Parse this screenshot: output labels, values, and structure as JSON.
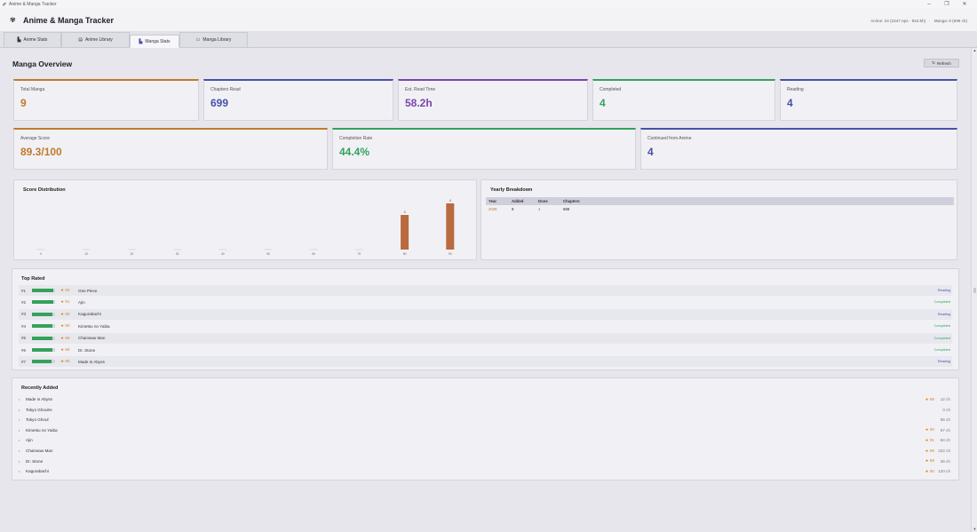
{
  "window": {
    "title": "Anime & Manga Tracker",
    "controls": [
      "–",
      "❐",
      "✕"
    ]
  },
  "header": {
    "title": "Anime & Manga Tracker",
    "anime_stat": "Anime: 24 (2347 eps · 934.5h)",
    "separator": "·",
    "manga_stat": "Manga: 9 (699 ch)"
  },
  "tabs": [
    {
      "label": "Anime Stats",
      "icon": "chart-icon",
      "active": false
    },
    {
      "label": "Anime Library",
      "icon": "library-icon",
      "active": false
    },
    {
      "label": "Manga Stats",
      "icon": "chart-icon",
      "active": true
    },
    {
      "label": "Manga Library",
      "icon": "book-icon",
      "active": false
    }
  ],
  "page": {
    "title": "Manga Overview",
    "refresh_label": "Refresh"
  },
  "stats_row1": [
    {
      "label": "Total Manga",
      "value": "9",
      "color": "#c07a2c"
    },
    {
      "label": "Chapters Read",
      "value": "699",
      "color": "#4650a8"
    },
    {
      "label": "Est. Read Time",
      "value": "58.2h",
      "color": "#7b44ad"
    },
    {
      "label": "Completed",
      "value": "4",
      "color": "#33a25c"
    },
    {
      "label": "Reading",
      "value": "4",
      "color": "#4650a8"
    }
  ],
  "stats_row2": [
    {
      "label": "Average Score",
      "value": "89.3/100",
      "color": "#c07a2c"
    },
    {
      "label": "Completion Rate",
      "value": "44.4%",
      "color": "#33a25c"
    },
    {
      "label": "Continued from Anime",
      "value": "4",
      "color": "#4650a8"
    }
  ],
  "score_distribution": {
    "title": "Score Distribution",
    "bar_color": "#b96a3e",
    "chart_data": {
      "type": "bar",
      "categories": [
        "0",
        "10",
        "20",
        "30",
        "40",
        "50",
        "60",
        "70",
        "80",
        "90"
      ],
      "values": [
        0,
        0,
        0,
        0,
        0,
        0,
        0,
        0,
        3,
        4
      ],
      "value_labels": [
        "",
        "",
        "",
        "",
        "",
        "",
        "",
        "",
        "3",
        "4"
      ],
      "ylim": [
        0,
        4
      ],
      "grid": false
    }
  },
  "yearly": {
    "title": "Yearly Breakdown",
    "headers": [
      "Year",
      "Added",
      "Done",
      "Chapters"
    ],
    "rows": [
      {
        "year": "2026",
        "added": "9",
        "done": "4",
        "chapters": "699"
      }
    ]
  },
  "top_rated": {
    "title": "Top Rated",
    "items": [
      {
        "rank": "#1",
        "score": "★ 92",
        "pct": 0.92,
        "name": "One Piece",
        "status": "Reading",
        "status_color": "#4650a8"
      },
      {
        "rank": "#2",
        "score": "★ 91",
        "pct": 0.91,
        "name": "Ajin",
        "status": "Completed",
        "status_color": "#33a25c"
      },
      {
        "rank": "#3",
        "score": "★ 90",
        "pct": 0.9,
        "name": "Kagurabachi",
        "status": "Reading",
        "status_color": "#4650a8"
      },
      {
        "rank": "#4",
        "score": "★ 90",
        "pct": 0.9,
        "name": "Kimetsu no Yaiba",
        "status": "Completed",
        "status_color": "#33a25c"
      },
      {
        "rank": "#5",
        "score": "★ 89",
        "pct": 0.89,
        "name": "Chainsaw Man",
        "status": "Completed",
        "status_color": "#33a25c"
      },
      {
        "rank": "#6",
        "score": "★ 88",
        "pct": 0.88,
        "name": "Dr. Stone",
        "status": "Completed",
        "status_color": "#33a25c"
      },
      {
        "rank": "#7",
        "score": "★ 85",
        "pct": 0.85,
        "name": "Made in Abyss",
        "status": "Reading",
        "status_color": "#4650a8"
      }
    ]
  },
  "recently_added": {
    "title": "Recently Added",
    "items": [
      {
        "name": "Made in Abyss",
        "score": "★ 85",
        "chapters": "12 ch"
      },
      {
        "name": "Tokyo Ghoulre",
        "score": "",
        "chapters": "0 ch"
      },
      {
        "name": "Tokyo Ghoul",
        "score": "",
        "chapters": "55 ch"
      },
      {
        "name": "Kimetsu no Yaiba",
        "score": "★ 90",
        "chapters": "67 ch"
      },
      {
        "name": "Ajin",
        "score": "★ 91",
        "chapters": "84 ch"
      },
      {
        "name": "Chainsaw Man",
        "score": "★ 89",
        "chapters": "232 ch"
      },
      {
        "name": "Dr. Stone",
        "score": "★ 88",
        "chapters": "36 ch"
      },
      {
        "name": "Kagurabachi",
        "score": "★ 90",
        "chapters": "120 ch"
      }
    ]
  }
}
